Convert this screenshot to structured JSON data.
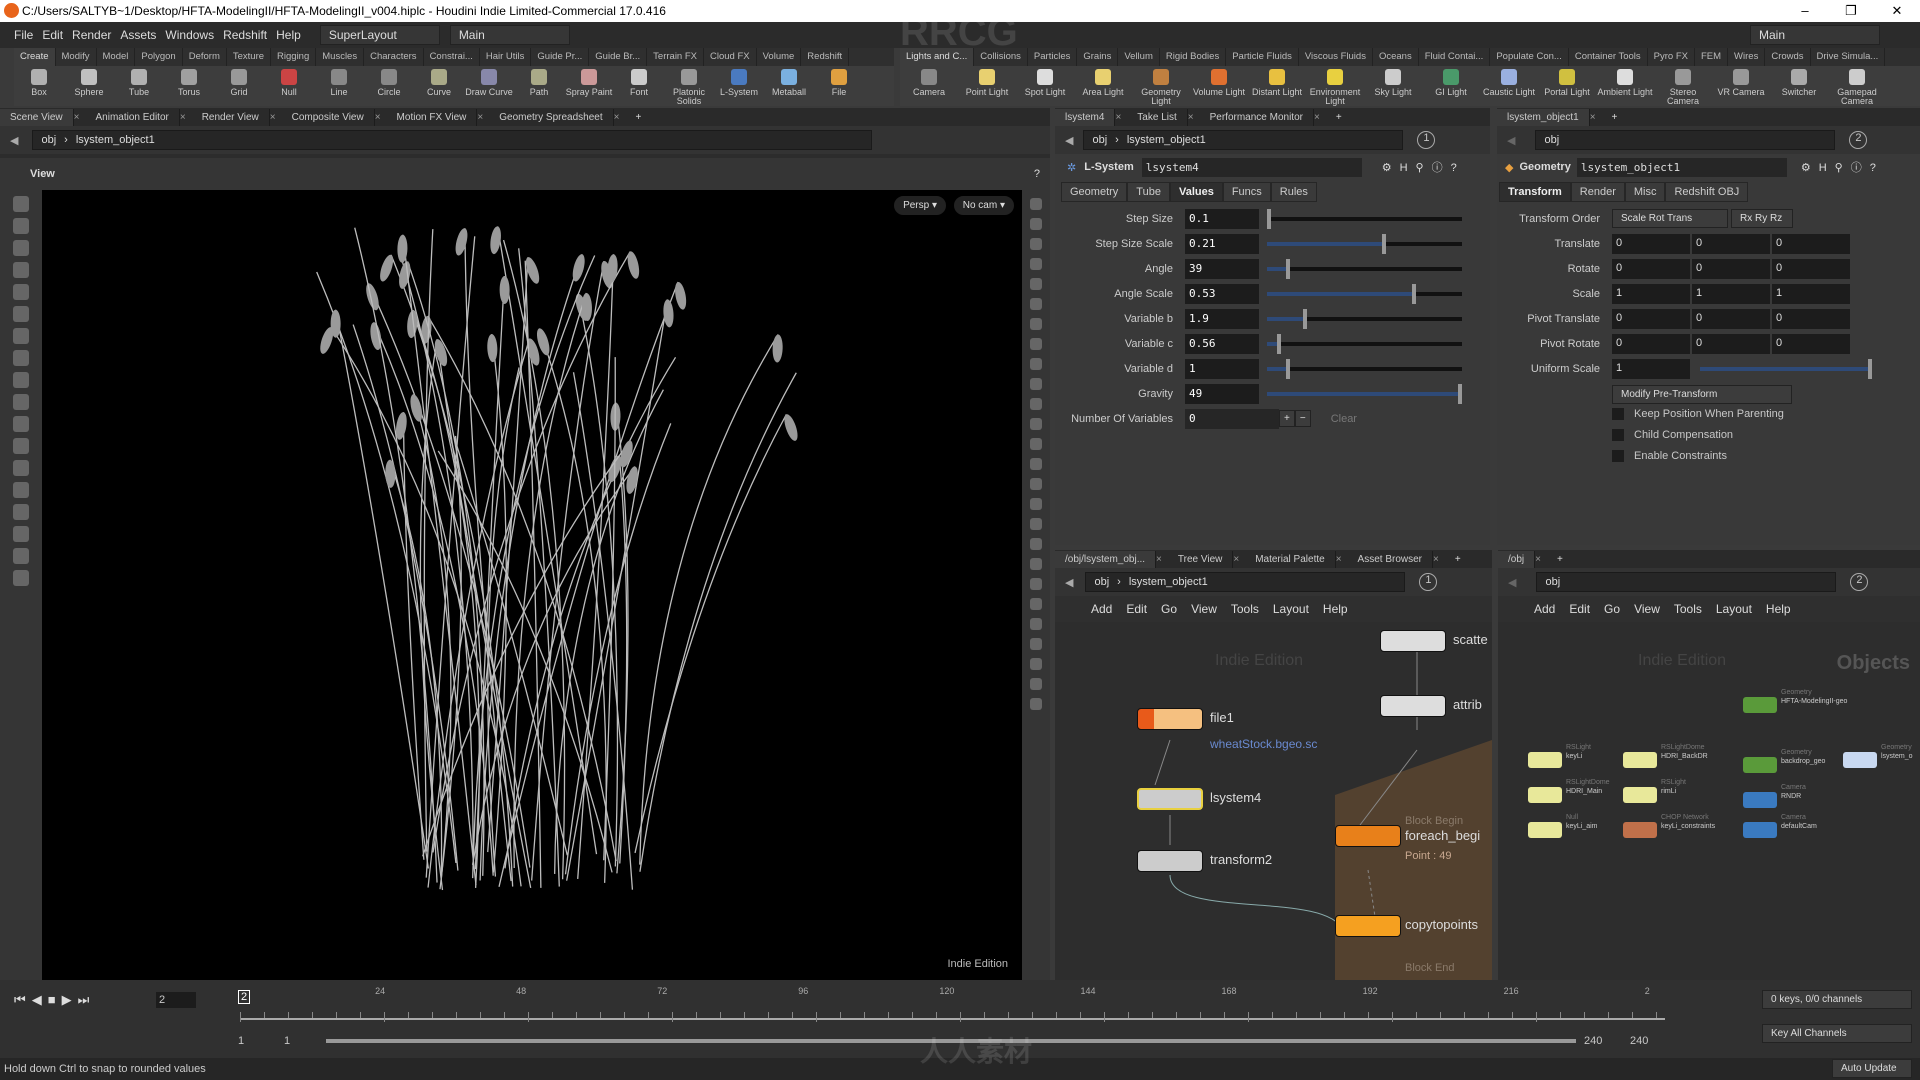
{
  "window": {
    "title": "C:/Users/SALTYB~1/Desktop/HFTA-ModelingII/HFTA-ModelingII_v004.hiplc - Houdini Indie Limited-Commercial 17.0.416",
    "controls": [
      "–",
      "❐",
      "✕"
    ]
  },
  "menu": {
    "items": [
      "File",
      "Edit",
      "Render",
      "Assets",
      "Windows",
      "Redshift",
      "Help"
    ],
    "desktop": "SuperLayout",
    "context": "Main",
    "right_context": "Main"
  },
  "shelf_left": {
    "tabs": [
      "Create",
      "Modify",
      "Model",
      "Polygon",
      "Deform",
      "Texture",
      "Rigging",
      "Muscles",
      "Characters",
      "Constrai...",
      "Hair Utils",
      "Guide Pr...",
      "Guide Br...",
      "Terrain FX",
      "Cloud FX",
      "Volume",
      "Redshift"
    ],
    "tools": [
      {
        "label": "Box",
        "color": "#b0b0b0"
      },
      {
        "label": "Sphere",
        "color": "#c0c0c0"
      },
      {
        "label": "Tube",
        "color": "#b0b0b0"
      },
      {
        "label": "Torus",
        "color": "#a0a0a0"
      },
      {
        "label": "Grid",
        "color": "#999"
      },
      {
        "label": "Null",
        "color": "#c44"
      },
      {
        "label": "Line",
        "color": "#888"
      },
      {
        "label": "Circle",
        "color": "#888"
      },
      {
        "label": "Curve",
        "color": "#aa8"
      },
      {
        "label": "Draw Curve",
        "color": "#88a"
      },
      {
        "label": "Path",
        "color": "#aa8"
      },
      {
        "label": "Spray Paint",
        "color": "#c99"
      },
      {
        "label": "Font",
        "color": "#ccc"
      },
      {
        "label": "Platonic Solids",
        "color": "#999"
      },
      {
        "label": "L-System",
        "color": "#4a7ac0"
      },
      {
        "label": "Metaball",
        "color": "#7ab0e0"
      },
      {
        "label": "File",
        "color": "#e0a040"
      }
    ]
  },
  "shelf_right": {
    "tabs": [
      "Lights and C...",
      "Collisions",
      "Particles",
      "Grains",
      "Vellum",
      "Rigid Bodies",
      "Particle Fluids",
      "Viscous Fluids",
      "Oceans",
      "Fluid Contai...",
      "Populate Con...",
      "Container Tools",
      "Pyro FX",
      "FEM",
      "Wires",
      "Crowds",
      "Drive Simula..."
    ],
    "tools": [
      {
        "label": "Camera",
        "color": "#888"
      },
      {
        "label": "Point Light",
        "color": "#e8d070"
      },
      {
        "label": "Spot Light",
        "color": "#ddd"
      },
      {
        "label": "Area Light",
        "color": "#e8d070"
      },
      {
        "label": "Geometry Light",
        "color": "#c08040"
      },
      {
        "label": "Volume Light",
        "color": "#e07030"
      },
      {
        "label": "Distant Light",
        "color": "#e8c040"
      },
      {
        "label": "Environment Light",
        "color": "#e8d040"
      },
      {
        "label": "Sky Light",
        "color": "#ccc"
      },
      {
        "label": "GI Light",
        "color": "#4a9a6a"
      },
      {
        "label": "Caustic Light",
        "color": "#9ab0e0"
      },
      {
        "label": "Portal Light",
        "color": "#d0c040"
      },
      {
        "label": "Ambient Light",
        "color": "#ddd"
      },
      {
        "label": "Stereo Camera",
        "color": "#999"
      },
      {
        "label": "VR Camera",
        "color": "#999"
      },
      {
        "label": "Switcher",
        "color": "#aaa"
      },
      {
        "label": "Gamepad Camera",
        "color": "#ccc"
      }
    ]
  },
  "scene_view": {
    "tabs": [
      "Scene View",
      "Animation Editor",
      "Render View",
      "Composite View",
      "Motion FX View",
      "Geometry Spreadsheet"
    ],
    "path": [
      "obj",
      "lsystem_object1"
    ],
    "toolbar_label": "View",
    "persp": "Persp ▾",
    "cam": "No cam ▾",
    "edition": "Indie Edition"
  },
  "params_left": {
    "tabs": [
      "lsystem4",
      "Take List",
      "Performance Monitor"
    ],
    "path": [
      "obj",
      "lsystem_object1"
    ],
    "pane_number": "1",
    "node_type": "L-System",
    "node_name": "lsystem4",
    "param_tabs": [
      "Geometry",
      "Tube",
      "Values",
      "Funcs",
      "Rules"
    ],
    "active_tab": "Values",
    "params": [
      {
        "label": "Step Size",
        "value": "0.1",
        "slider": 0.0
      },
      {
        "label": "Step Size Scale",
        "value": "0.21",
        "slider": 0.6
      },
      {
        "label": "Angle",
        "value": "39",
        "slider": 0.1
      },
      {
        "label": "Angle Scale",
        "value": "0.53",
        "slider": 0.76
      },
      {
        "label": "Variable b",
        "value": "1.9",
        "slider": 0.19
      },
      {
        "label": "Variable c",
        "value": "0.56",
        "slider": 0.05
      },
      {
        "label": "Variable d",
        "value": "1",
        "slider": 0.1
      },
      {
        "label": "Gravity",
        "value": "49",
        "slider": 1.0
      }
    ],
    "num_vars_label": "Number Of Variables",
    "num_vars": "0",
    "plus": "+",
    "minus": "−",
    "clear": "Clear"
  },
  "params_right": {
    "tabs": [
      "lsystem_object1"
    ],
    "path": [
      "obj"
    ],
    "pane_number": "2",
    "node_type": "Geometry",
    "node_name": "lsystem_object1",
    "param_tabs": [
      "Transform",
      "Render",
      "Misc",
      "Redshift OBJ"
    ],
    "transform_order_label": "Transform Order",
    "transform_order": "Scale Rot Trans",
    "rot_order": "Rx Ry Rz",
    "vectors": [
      {
        "label": "Translate",
        "values": [
          "0",
          "0",
          "0"
        ]
      },
      {
        "label": "Rotate",
        "values": [
          "0",
          "0",
          "0"
        ]
      },
      {
        "label": "Scale",
        "values": [
          "1",
          "1",
          "1"
        ]
      },
      {
        "label": "Pivot Translate",
        "values": [
          "0",
          "0",
          "0"
        ]
      },
      {
        "label": "Pivot Rotate",
        "values": [
          "0",
          "0",
          "0"
        ]
      }
    ],
    "uniform_scale_label": "Uniform Scale",
    "uniform_scale": "1",
    "modify_menu": "Modify Pre-Transform",
    "checkboxes": [
      "Keep Position When Parenting",
      "Child Compensation",
      "Enable Constraints"
    ]
  },
  "network_left": {
    "tabs": [
      "/obj/lsystem_obj...",
      "Tree View",
      "Material Palette",
      "Asset Browser"
    ],
    "path": [
      "obj",
      "lsystem_object1"
    ],
    "pane_number": "1",
    "menu": [
      "Add",
      "Edit",
      "Go",
      "View",
      "Tools",
      "Layout",
      "Help"
    ],
    "edition": "Indie Edition",
    "nodes": {
      "file1": "file1",
      "file1_path": "wheatStock.bgeo.sc",
      "lsystem4": "lsystem4",
      "transform2": "transform2",
      "scatter": "scatte",
      "attrib": "attrib",
      "block_begin": "Block Begin",
      "foreach": "foreach_begi",
      "foreach_info": "Point : 49",
      "copy": "copytopoints",
      "block_end": "Block End"
    }
  },
  "network_right": {
    "tabs": [
      "/obj"
    ],
    "path": [
      "obj"
    ],
    "pane_number": "2",
    "menu": [
      "Add",
      "Edit",
      "Go",
      "View",
      "Tools",
      "Layout",
      "Help"
    ],
    "edition": "Indie Edition",
    "context_label": "Objects",
    "nodes": [
      {
        "type": "RSLight",
        "name": "keyLi",
        "color": "#e8e89a"
      },
      {
        "type": "RSLightDome",
        "name": "HDRI_BackDR",
        "color": "#e8e89a"
      },
      {
        "type": "RSLightDome",
        "name": "HDRI_Main",
        "color": "#e8e89a"
      },
      {
        "type": "RSLight",
        "name": "rimLi",
        "color": "#e8e89a"
      },
      {
        "type": "Null",
        "name": "keyLi_aim",
        "color": "#e8e89a"
      },
      {
        "type": "CHOP Network",
        "name": "keyLi_constraints",
        "color": "#c0704a"
      },
      {
        "type": "Geometry",
        "name": "HFTA-ModelingII-geo",
        "color": "#5a9a3a"
      },
      {
        "type": "Geometry",
        "name": "backdrop_geo",
        "color": "#5a9a3a"
      },
      {
        "type": "Camera",
        "name": "RNDR",
        "color": "#3a7ac0"
      },
      {
        "type": "Camera",
        "name": "defaultCam",
        "color": "#3a7ac0"
      },
      {
        "type": "Geometry",
        "name": "lsystem_o",
        "color": "#c8d8f0"
      }
    ]
  },
  "timeline": {
    "current_frame": "2",
    "ticks": [
      "24",
      "48",
      "72",
      "96",
      "120",
      "144",
      "168",
      "192",
      "216",
      "2"
    ],
    "start": "1",
    "range_start": "1",
    "range_end": "240",
    "end": "240",
    "keys_info": "0 keys, 0/0 channels",
    "key_channels": "Key All Channels",
    "update_mode": "Auto Update"
  },
  "status": {
    "message": "Hold down Ctrl to snap to rounded values"
  },
  "watermarks": [
    "RRCG",
    "人人素材"
  ]
}
